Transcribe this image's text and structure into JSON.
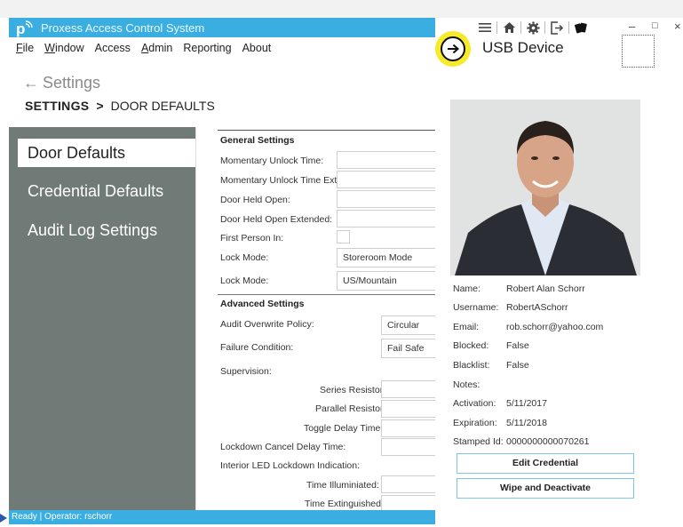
{
  "app": {
    "title": "Proxess Access Control System"
  },
  "menu": [
    {
      "pre": "",
      "u": "F",
      "post": "ile"
    },
    {
      "pre": "",
      "u": "W",
      "post": "indow"
    },
    {
      "pre": "Access",
      "u": "",
      "post": ""
    },
    {
      "pre": "",
      "u": "A",
      "post": "dmin"
    },
    {
      "pre": "Reporting",
      "u": "",
      "post": ""
    },
    {
      "pre": "About",
      "u": "",
      "post": ""
    }
  ],
  "nav": {
    "back_label": "Settings",
    "breadcrumb_root": "SETTINGS",
    "breadcrumb_sep": ">",
    "breadcrumb_current": "DOOR DEFAULTS"
  },
  "sidebar": {
    "items": [
      {
        "label": "Door Defaults"
      },
      {
        "label": "Credential Defaults"
      },
      {
        "label": "Audit Log Settings"
      }
    ]
  },
  "general": {
    "heading": "General Settings",
    "momentary_unlock": "Momentary Unlock Time:",
    "momentary_unlock_ext": "Momentary Unlock Time Ext:",
    "door_held_open": "Door Held Open:",
    "door_held_open_ext": "Door Held Open Extended:",
    "first_person_in": "First Person In:",
    "lock_mode_1": "Lock Mode:",
    "lock_mode_1_value": "Storeroom Mode",
    "lock_mode_2": "Lock Mode:",
    "lock_mode_2_value": "US/Mountain"
  },
  "advanced": {
    "heading": "Advanced Settings",
    "audit_overwrite": "Audit Overwrite Policy:",
    "audit_overwrite_value": "Circular",
    "failure_condition": "Failure Condition:",
    "failure_condition_value": "Fail Safe",
    "supervision": "Supervision:",
    "series_resistor": "Series Resistor:",
    "parallel_resistor": "Parallel Resistor:",
    "toggle_delay": "Toggle Delay Time:",
    "lockdown_cancel": "Lockdown Cancel Delay Time:",
    "interior_led": "Interior LED Lockdown Indication:",
    "time_illuminated": "Time Illuminiated:",
    "time_extinguished": "Time Extinguished:"
  },
  "status": {
    "text": "Ready | Operator: rschorr"
  },
  "device_panel": {
    "title": "USB Device",
    "info": [
      {
        "label": "Name:",
        "value": "Robert Alan Schorr"
      },
      {
        "label": "Username:",
        "value": "RobertASchorr"
      },
      {
        "label": "Email:",
        "value": "rob.schorr@yahoo.com"
      },
      {
        "label": "Blocked:",
        "value": "False"
      },
      {
        "label": "Blacklist:",
        "value": "False"
      },
      {
        "label": "Notes:",
        "value": ""
      },
      {
        "label": "Activation:",
        "value": "5/11/2017"
      },
      {
        "label": "Expiration:",
        "value": "5/11/2018"
      },
      {
        "label": "Stamped Id:",
        "value": "0000000000070261"
      }
    ],
    "edit_button": "Edit Credential",
    "wipe_button": "Wipe and Deactivate"
  },
  "icons": {
    "menu": "hamburger-icon",
    "home": "home-icon",
    "settings": "gear-icon",
    "logout": "sign-out-icon",
    "cards": "cards-icon"
  },
  "colors": {
    "accent": "#3aaee0",
    "sidebar": "#707b77",
    "highlight": "#f7ea2b"
  }
}
